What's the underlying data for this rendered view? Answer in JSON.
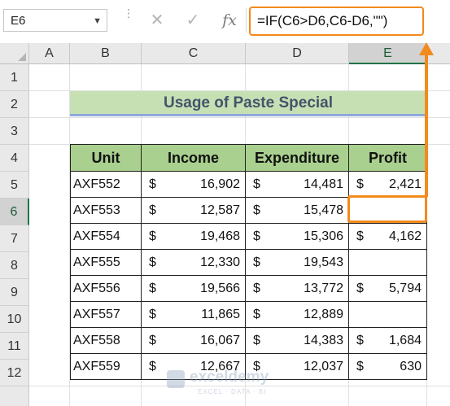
{
  "formula_bar": {
    "name_box": "E6",
    "cancel_icon": "✕",
    "enter_icon": "✓",
    "fx_label": "fx",
    "formula": "=IF(C6>D6,C6-D6,\"\")"
  },
  "columns": [
    "A",
    "B",
    "C",
    "D",
    "E"
  ],
  "rows": [
    "1",
    "2",
    "3",
    "4",
    "5",
    "6",
    "7",
    "8",
    "9",
    "10",
    "11",
    "12"
  ],
  "selected_cell": "E6",
  "title": "Usage of Paste Special",
  "table": {
    "headers": [
      "Unit",
      "Income",
      "Expenditure",
      "Profit"
    ],
    "currency": "$",
    "rows": [
      {
        "unit": "AXF552",
        "income": "16,902",
        "expenditure": "14,481",
        "profit": "2,421"
      },
      {
        "unit": "AXF553",
        "income": "12,587",
        "expenditure": "15,478",
        "profit": ""
      },
      {
        "unit": "AXF554",
        "income": "19,468",
        "expenditure": "15,306",
        "profit": "4,162"
      },
      {
        "unit": "AXF555",
        "income": "12,330",
        "expenditure": "19,543",
        "profit": ""
      },
      {
        "unit": "AXF556",
        "income": "19,566",
        "expenditure": "13,772",
        "profit": "5,794"
      },
      {
        "unit": "AXF557",
        "income": "11,865",
        "expenditure": "12,889",
        "profit": ""
      },
      {
        "unit": "AXF558",
        "income": "16,067",
        "expenditure": "14,383",
        "profit": "1,684"
      },
      {
        "unit": "AXF559",
        "income": "12,667",
        "expenditure": "12,037",
        "profit": "630"
      }
    ]
  },
  "watermark": {
    "name": "exceldemy",
    "tagline": "EXCEL · DATA · BI"
  },
  "colors": {
    "highlight": "#f28a1c",
    "header_fill": "#a9d08e",
    "title_fill": "#c6e0b4",
    "title_text": "#44546a"
  }
}
